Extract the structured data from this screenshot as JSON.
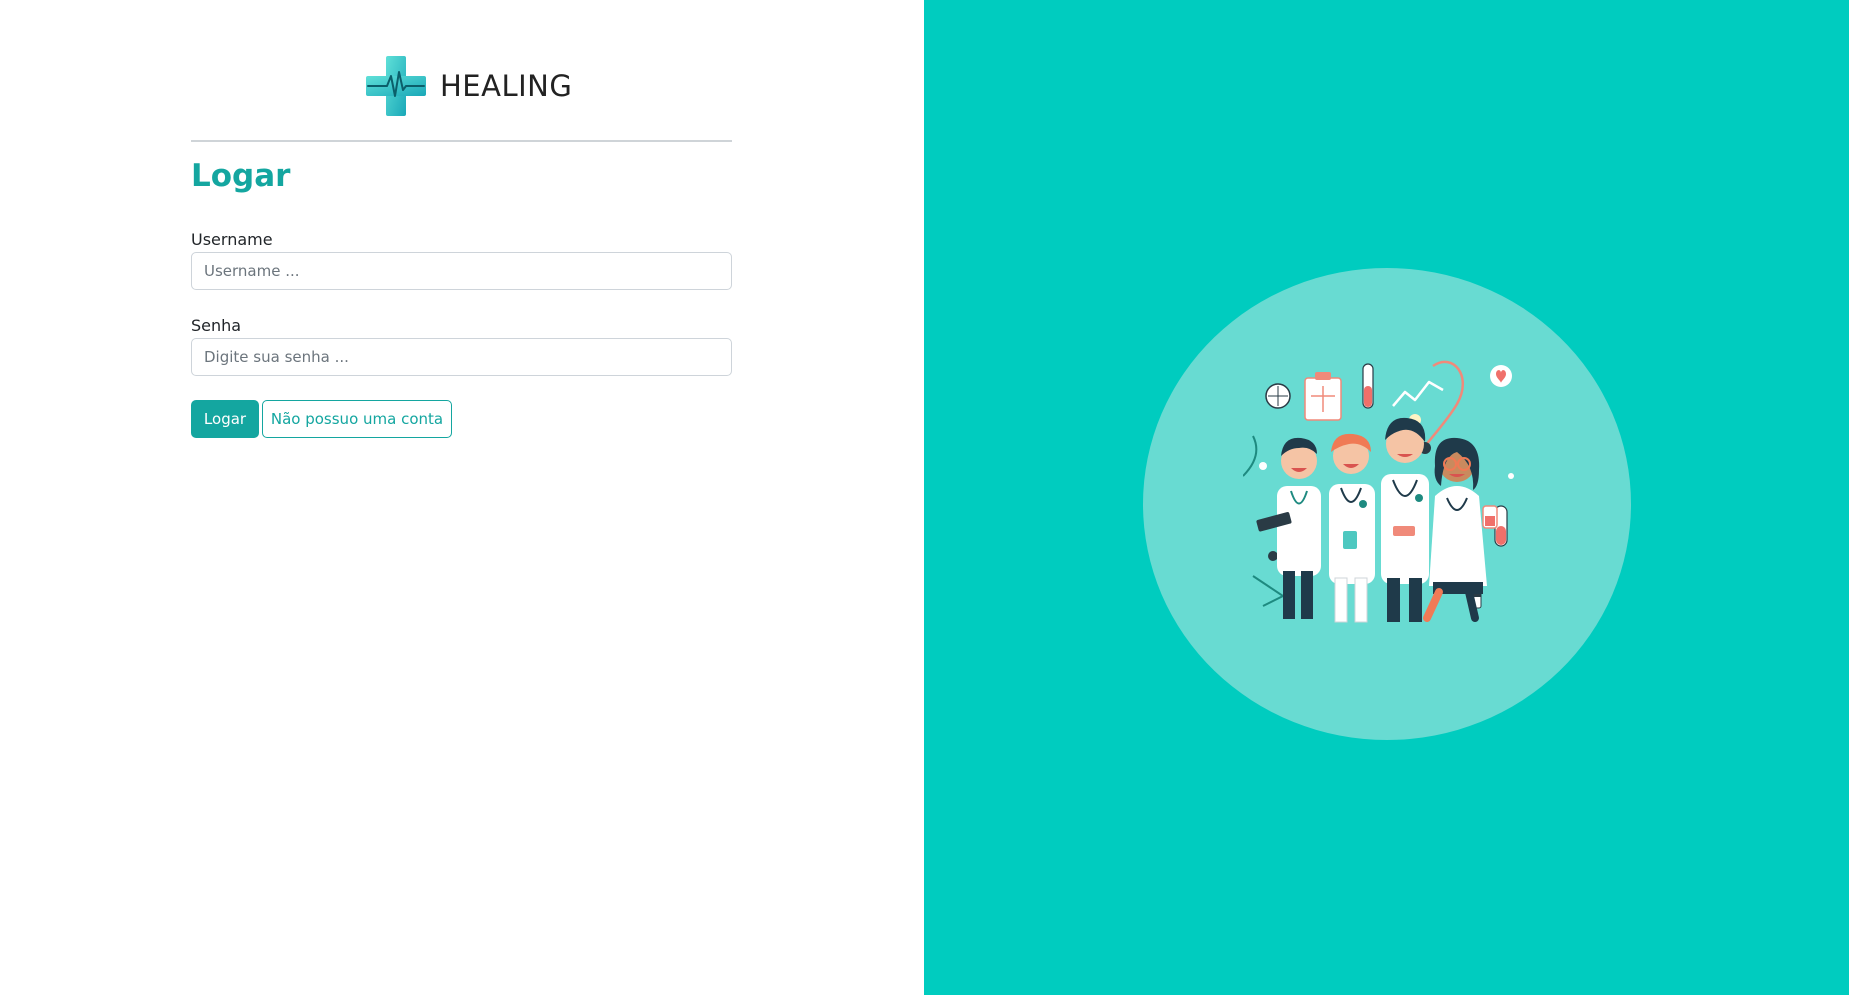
{
  "brand": {
    "name": "HEALING",
    "logo_icon": "medical-cross-heartbeat-icon"
  },
  "login_form": {
    "title": "Logar",
    "username": {
      "label": "Username",
      "value": "",
      "placeholder": "Username ..."
    },
    "password": {
      "label": "Senha",
      "value": "",
      "placeholder": "Digite sua senha ..."
    },
    "submit_label": "Logar",
    "register_label": "Não possuo uma conta"
  },
  "hero": {
    "illustration": "doctors-team-illustration"
  },
  "colors": {
    "accent": "#14a6a0",
    "right_panel_bg": "#00ccbf",
    "circle_bg": "#68dbd2"
  }
}
